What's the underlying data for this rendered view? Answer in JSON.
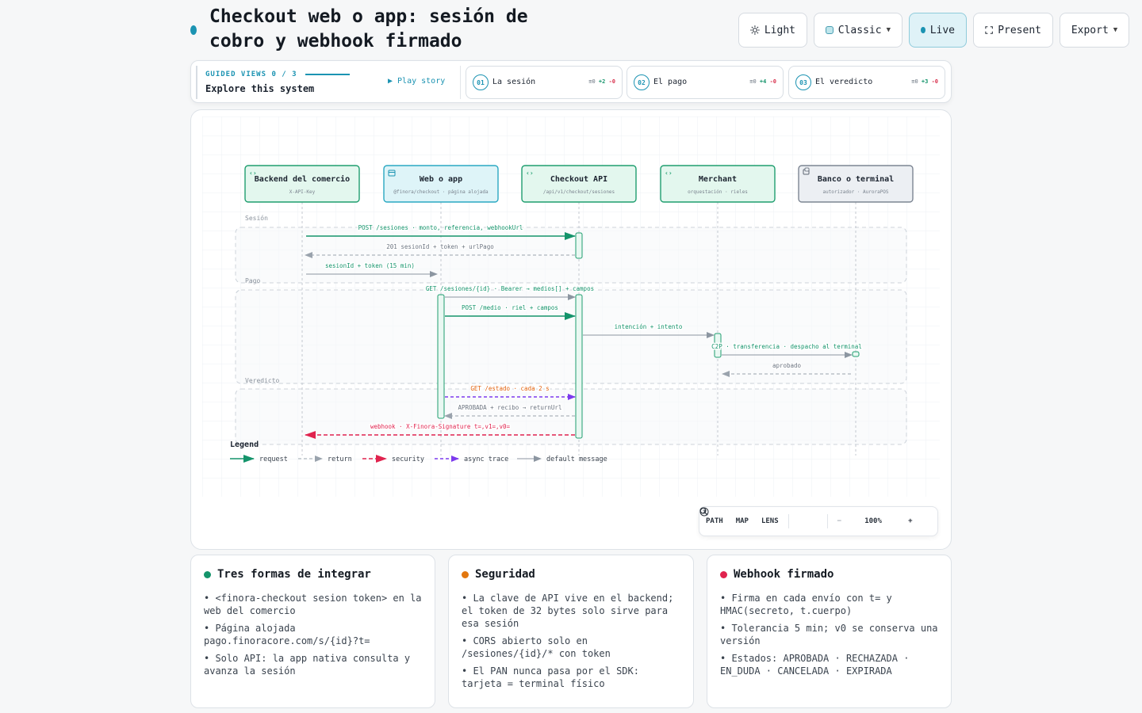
{
  "header": {
    "title": "Checkout web o app: sesión de cobro y webhook firmado",
    "accent": "#1b93b2"
  },
  "toolbar": {
    "light": "Light",
    "theme": "Classic",
    "live": "Live",
    "present": "Present",
    "export": "Export"
  },
  "guided": {
    "label": "GUIDED VIEWS  0 / 3",
    "subtitle": "Explore this system",
    "play": "▶ Play story",
    "steps": [
      {
        "num": "01",
        "name": "La sesión",
        "eq": "≡0",
        "plus": "+2",
        "minus": "-0"
      },
      {
        "num": "02",
        "name": "El pago",
        "eq": "≡0",
        "plus": "+4",
        "minus": "-0"
      },
      {
        "num": "03",
        "name": "El veredicto",
        "eq": "≡0",
        "plus": "+3",
        "minus": "-0"
      }
    ]
  },
  "diagram": {
    "participants": [
      {
        "name": "Backend del comercio",
        "sub": "X-API-Key",
        "kind": "green",
        "icon": "code-icon"
      },
      {
        "name": "Web o app",
        "sub": "@finora/checkout · página alojada",
        "kind": "cyan",
        "icon": "window-icon"
      },
      {
        "name": "Checkout API",
        "sub": "/api/v1/checkout/sesiones",
        "kind": "green",
        "icon": "code-icon"
      },
      {
        "name": "Merchant",
        "sub": "orquestación · rieles",
        "kind": "green",
        "icon": "code-icon"
      },
      {
        "name": "Banco o terminal",
        "sub": "autorizador · AuroraPOS",
        "kind": "gray",
        "icon": "terminal-icon"
      }
    ],
    "groups": [
      "Sesión",
      "Pago",
      "Veredicto"
    ],
    "messages": [
      {
        "from": 0,
        "to": 2,
        "label": "POST /sesiones · monto, referencia, webhookUrl",
        "style": "request",
        "group": 0
      },
      {
        "from": 2,
        "to": 0,
        "label": "201 sesionId + token + urlPago",
        "style": "return",
        "group": 0
      },
      {
        "from": 0,
        "to": 1,
        "label": "sesionId + token (15 min)",
        "style": "default",
        "group": 0
      },
      {
        "from": 1,
        "to": 2,
        "label": "GET /sesiones/{id} · Bearer → medios[] + campos",
        "style": "default",
        "group": 1
      },
      {
        "from": 1,
        "to": 2,
        "label": "POST /medio · riel + campos",
        "style": "request",
        "group": 1
      },
      {
        "from": 2,
        "to": 3,
        "label": "intención + intento",
        "style": "default",
        "group": 1
      },
      {
        "from": 3,
        "to": 4,
        "label": "C2P · transferencia · despacho al terminal",
        "style": "default",
        "group": 1
      },
      {
        "from": 4,
        "to": 3,
        "label": "aprobado",
        "style": "return",
        "group": 1
      },
      {
        "from": 1,
        "to": 2,
        "label": "GET /estado · cada 2 s",
        "style": "async",
        "group": 2
      },
      {
        "from": 2,
        "to": 1,
        "label": "APROBADA + recibo → returnUrl",
        "style": "return",
        "group": 2
      },
      {
        "from": 2,
        "to": 0,
        "label": "webhook · X-Finora-Signature t=,v1=,v0=",
        "style": "security",
        "group": 2
      }
    ],
    "legend": {
      "title": "Legend",
      "items": [
        {
          "style": "request",
          "label": "request"
        },
        {
          "style": "return",
          "label": "return"
        },
        {
          "style": "security",
          "label": "security"
        },
        {
          "style": "async",
          "label": "async trace"
        },
        {
          "style": "default",
          "label": "default message"
        }
      ]
    },
    "colors": {
      "request": "#14946b",
      "return": "#9aa3ad",
      "security": "#e0234e",
      "async": "#7c3aed",
      "default": "#8c96a1",
      "asyncLabel": "#e2620e"
    }
  },
  "zoom": {
    "path": "PATH",
    "map": "MAP",
    "lens": "LENS",
    "minus": "−",
    "level": "100%",
    "plus": "+"
  },
  "cards": [
    {
      "title": "Tres formas de integrar",
      "color": "#14946b",
      "items": [
        "• <finora-checkout sesion token> en la web del comercio",
        "• Página alojada pago.finoracore.com/s/{id}?t=",
        "• Solo API: la app nativa consulta y avanza la sesión"
      ]
    },
    {
      "title": "Seguridad",
      "color": "#e2770e",
      "items": [
        "• La clave de API vive en el backend; el token de 32 bytes solo sirve para esa sesión",
        "• CORS abierto solo en /sesiones/{id}/* con token",
        "• El PAN nunca pasa por el SDK: tarjeta = terminal físico"
      ]
    },
    {
      "title": "Webhook firmado",
      "color": "#e0234e",
      "items": [
        "• Firma en cada envío con t= y HMAC(secreto, t.cuerpo)",
        "• Tolerancia 5 min; v0 se conserva una versión",
        "• Estados: APROBADA · RECHAZADA · EN_DUDA · CANCELADA · EXPIRADA"
      ]
    }
  ]
}
